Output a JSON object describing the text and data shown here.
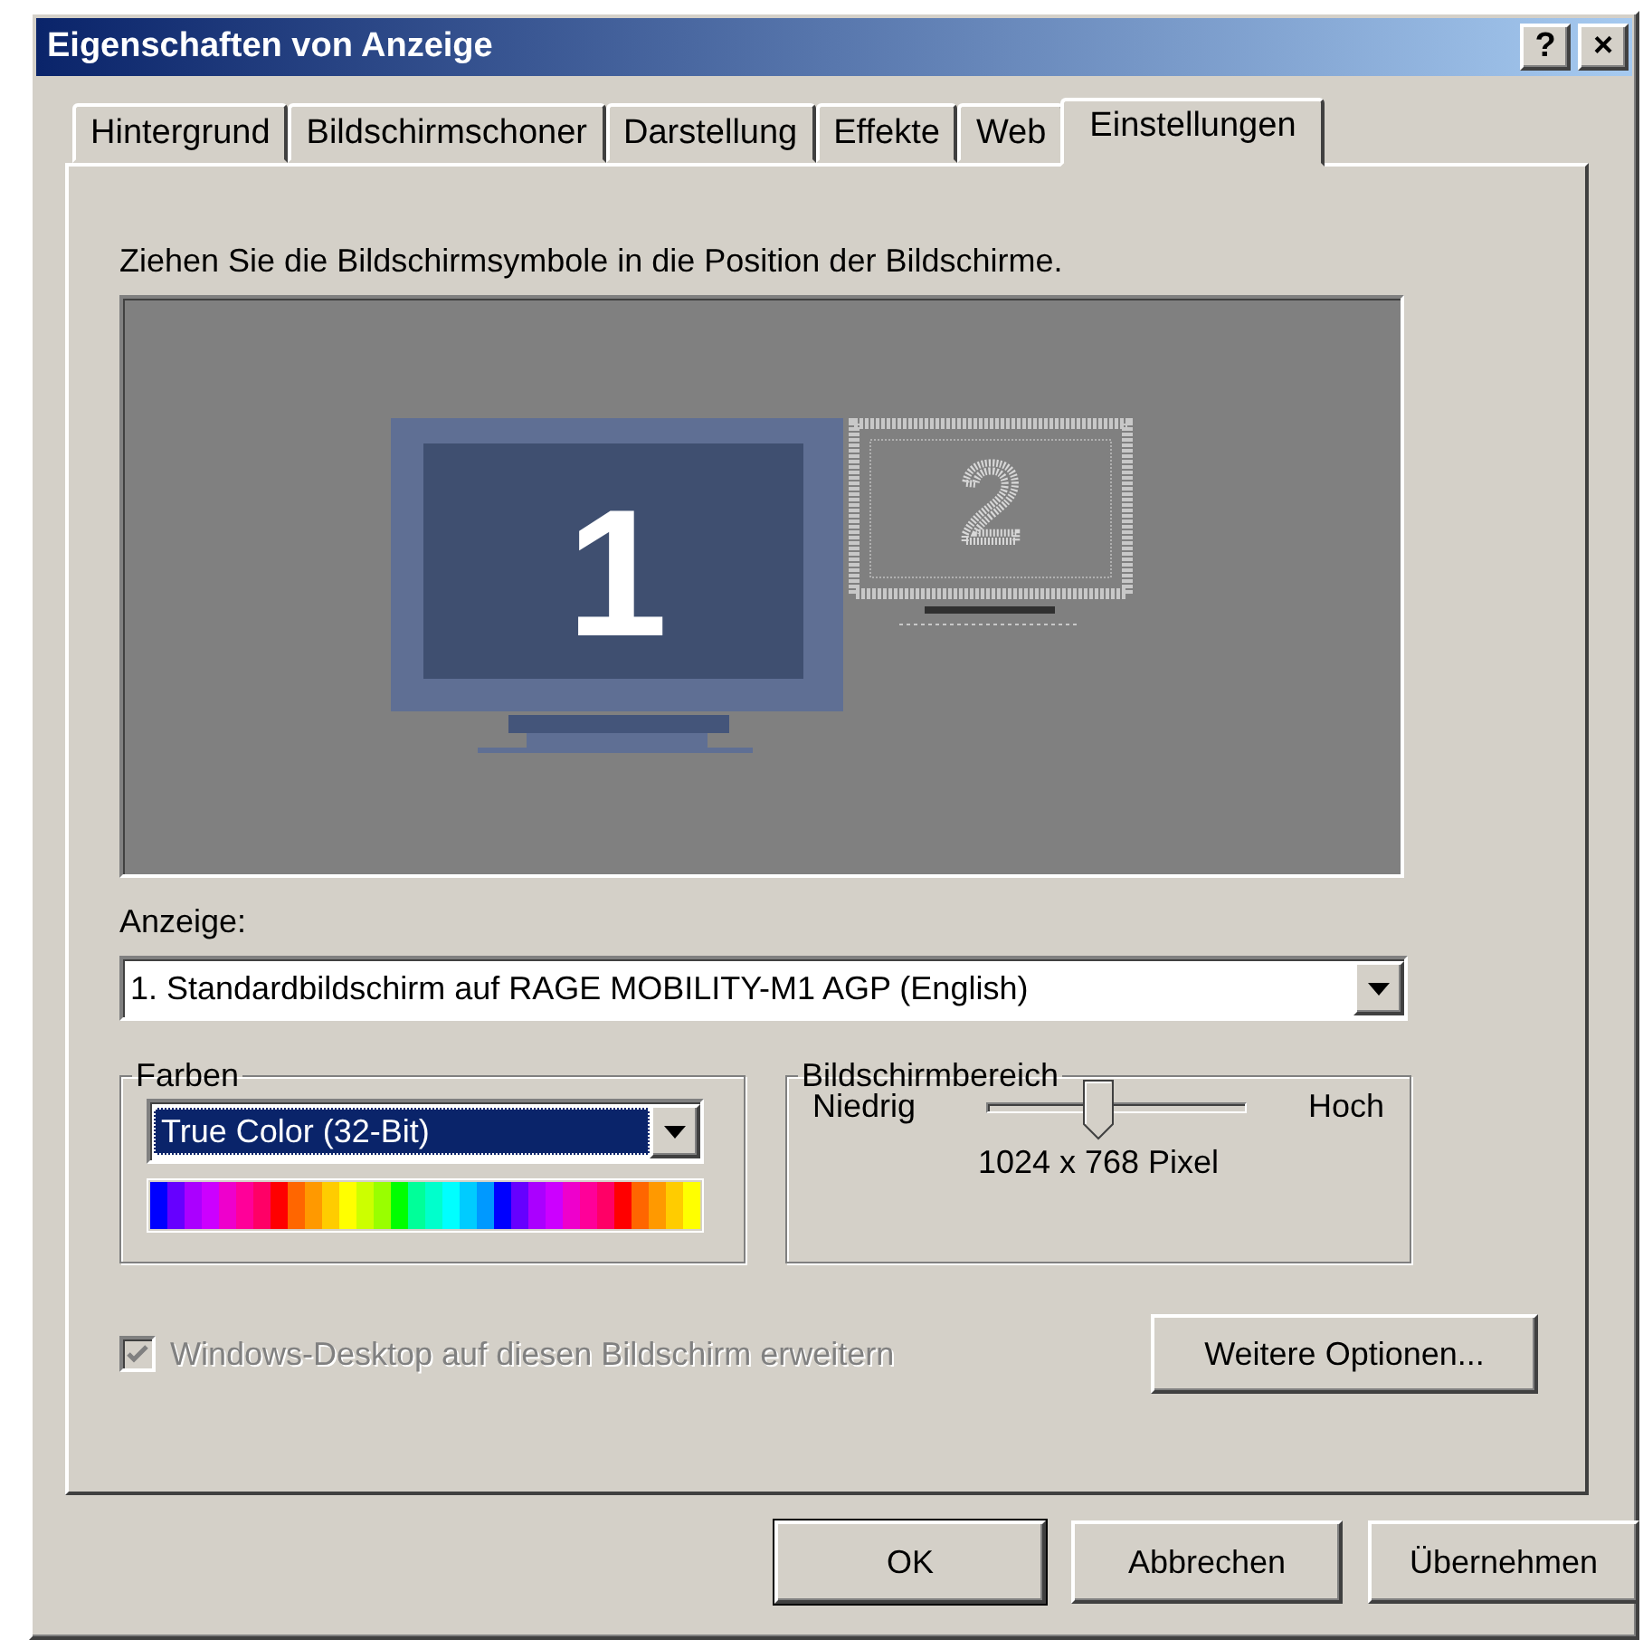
{
  "window": {
    "title": "Eigenschaften von Anzeige",
    "title_buttons": [
      "?",
      "×"
    ]
  },
  "tabs": [
    {
      "label": "Hintergrund",
      "selected": false
    },
    {
      "label": "Bildschirmschoner",
      "selected": false
    },
    {
      "label": "Darstellung",
      "selected": false
    },
    {
      "label": "Effekte",
      "selected": false
    },
    {
      "label": "Web",
      "selected": false
    },
    {
      "label": "Einstellungen",
      "selected": true
    }
  ],
  "instruction": "Ziehen Sie die Bildschirmsymbole in die Position der Bildschirme.",
  "monitors": [
    {
      "label": "1",
      "selected": true
    },
    {
      "label": "2",
      "selected": false
    }
  ],
  "display": {
    "label": "Anzeige:",
    "value": "1. Standardbildschirm auf RAGE MOBILITY-M1 AGP (English)"
  },
  "colors": {
    "legend": "Farben",
    "value": "True Color (32-Bit)"
  },
  "resolution": {
    "legend": "Bildschirmbereich",
    "low": "Niedrig",
    "high": "Hoch",
    "level": 0.43,
    "reading": "1024 x 768 Pixel"
  },
  "extend_desktop": {
    "label": "Windows-Desktop auf diesen Bildschirm erweitern",
    "checked": true,
    "disabled": true
  },
  "advanced_button": "Weitere Optionen...",
  "buttons": [
    {
      "label": "OK",
      "default": true
    },
    {
      "label": "Abbrechen",
      "default": false
    },
    {
      "label": "Übernehmen",
      "default": false
    }
  ]
}
